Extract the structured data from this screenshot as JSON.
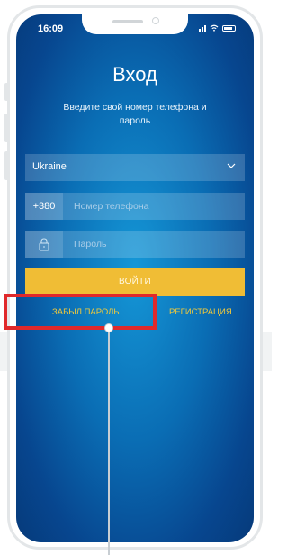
{
  "status_bar": {
    "time": "16:09"
  },
  "login": {
    "title": "Вход",
    "subtitle": "Введите свой номер телефона и пароль",
    "country_value": "Ukraine",
    "phone_prefix": "+380",
    "phone_placeholder": "Номер телефона",
    "password_placeholder": "Пароль",
    "login_button": "ВОЙТИ",
    "forgot_password": "ЗАБЫЛ ПАРОЛЬ",
    "register": "РЕГИСТРАЦИЯ"
  },
  "icons": [
    "signal-icon",
    "wifi-icon",
    "battery-icon",
    "chevron-down-icon",
    "lock-icon"
  ],
  "colors": {
    "accent_yellow": "#f0bd35",
    "link_yellow": "#f2c93a",
    "highlight_red": "#e0292b",
    "screen_blue": "#0a6db4"
  }
}
